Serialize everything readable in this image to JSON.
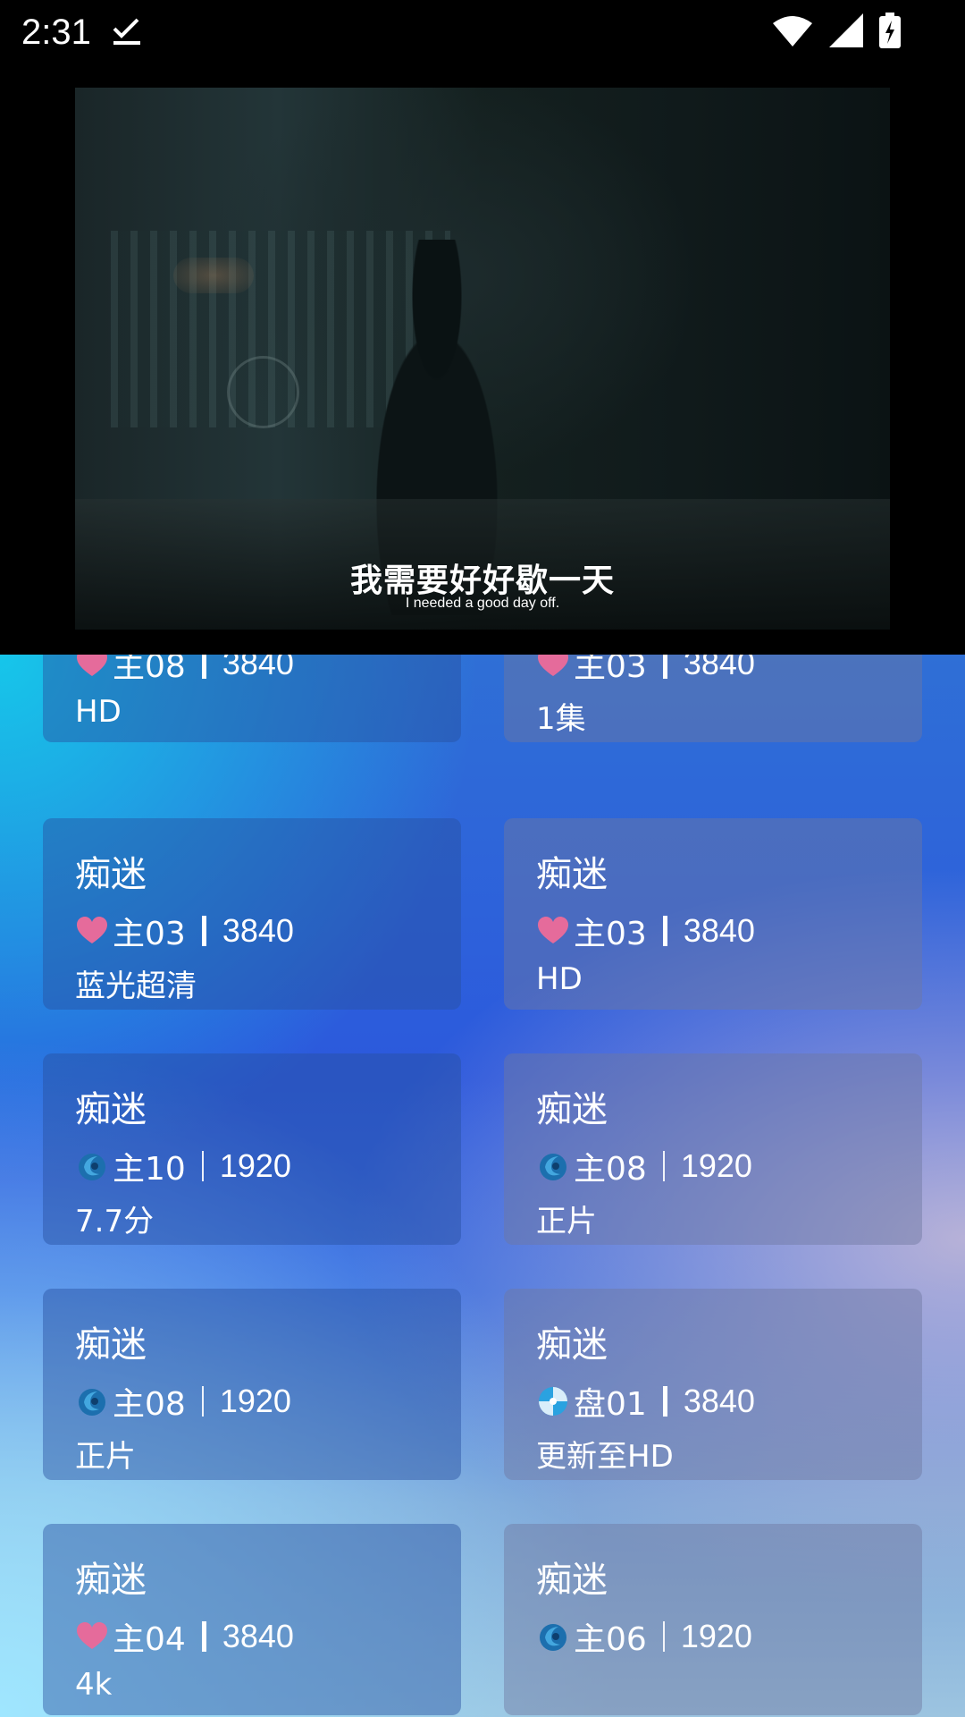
{
  "status_bar": {
    "time": "2:31"
  },
  "player": {
    "subtitle_zh": "我需要好好歇一天",
    "subtitle_en": "I needed a good day off."
  },
  "cards": [
    {
      "title": "",
      "icon": "heart-icon",
      "source": "主08",
      "resolution": "3840",
      "note": "HD"
    },
    {
      "title": "",
      "icon": "heart-icon",
      "source": "主03",
      "resolution": "3840",
      "note": "1集"
    },
    {
      "title": "痴迷",
      "icon": "heart-icon",
      "source": "主03",
      "resolution": "3840",
      "note": "蓝光超清"
    },
    {
      "title": "痴迷",
      "icon": "heart-icon",
      "source": "主03",
      "resolution": "3840",
      "note": "HD"
    },
    {
      "title": "痴迷",
      "icon": "swirl-icon",
      "source": "主10",
      "resolution": "1920",
      "note": "7.7分"
    },
    {
      "title": "痴迷",
      "icon": "swirl-icon",
      "source": "主08",
      "resolution": "1920",
      "note": "正片"
    },
    {
      "title": "痴迷",
      "icon": "swirl-icon",
      "source": "主08",
      "resolution": "1920",
      "note": "正片"
    },
    {
      "title": "痴迷",
      "icon": "disc-icon",
      "source": "盘01",
      "resolution": "3840",
      "note": "更新至HD"
    },
    {
      "title": "痴迷",
      "icon": "heart-icon",
      "source": "主04",
      "resolution": "3840",
      "note": "4k"
    },
    {
      "title": "痴迷",
      "icon": "swirl-icon",
      "source": "主06",
      "resolution": "1920",
      "note": ""
    }
  ]
}
